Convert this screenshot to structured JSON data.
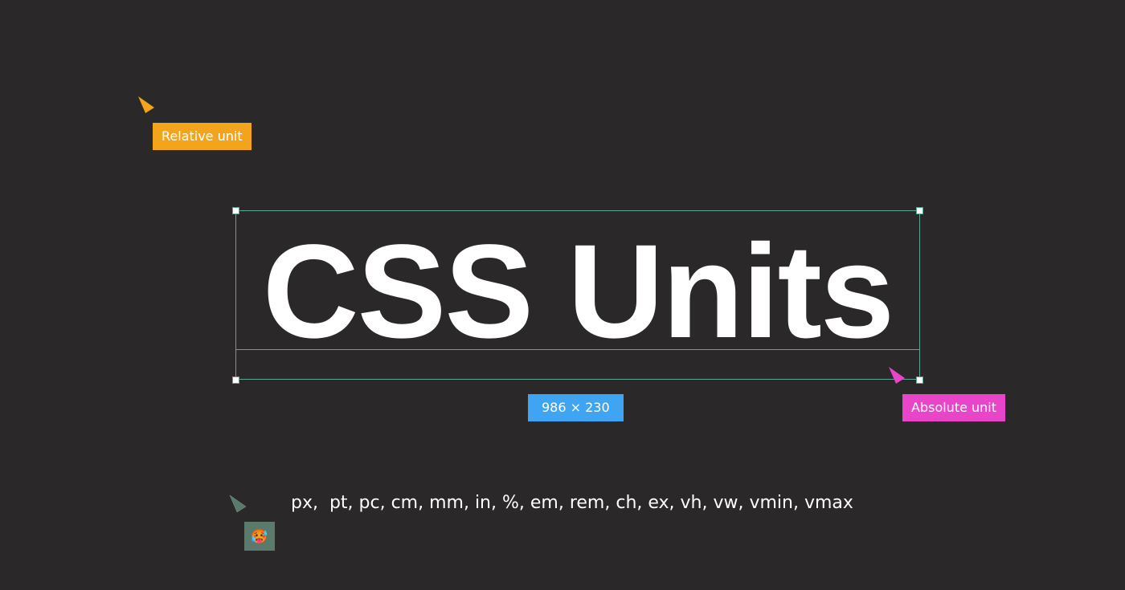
{
  "canvas": {
    "title": "CSS Units",
    "dimension_label": "986 × 230",
    "units_text": "px,  pt, pc, cm, mm, in, %, em, rem, ch, ex, vh, vw, vmin, vmax"
  },
  "collaborators": [
    {
      "label": "Relative unit",
      "color": "#f3a41d",
      "icon": "cursor-pointer-icon"
    },
    {
      "label": "Absolute unit",
      "color": "#e845c8",
      "icon": "cursor-pointer-icon"
    },
    {
      "label": "",
      "color": "#5b7a6c",
      "icon": "cursor-pointer-icon",
      "avatar": "🥵"
    }
  ],
  "colors": {
    "background": "#2a2829",
    "selection": "#5fa596",
    "dimension_badge": "#3fa5f3"
  }
}
